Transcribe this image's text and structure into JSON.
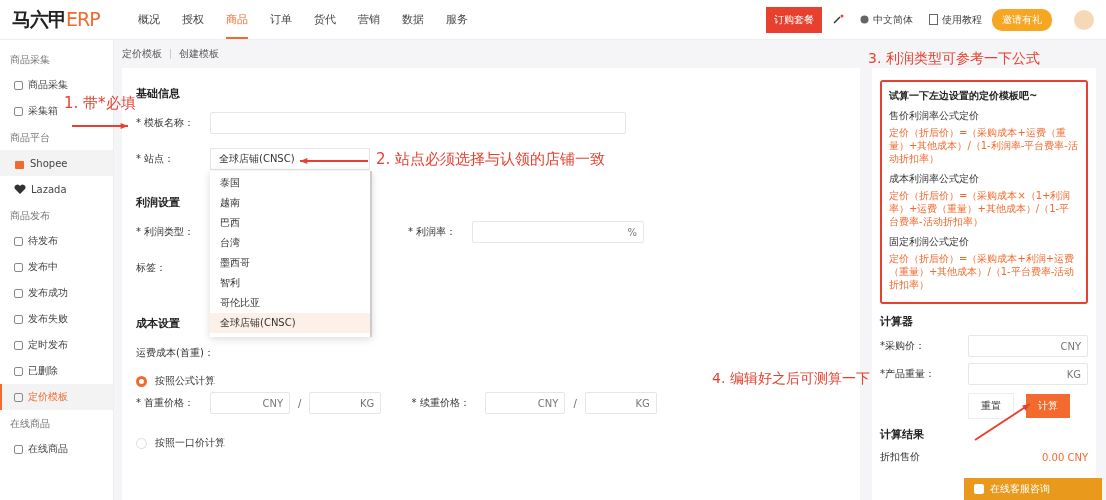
{
  "top_nav": {
    "logo": {
      "main": "马六甲",
      "accent": "ERP"
    },
    "tabs": [
      {
        "label": "概况",
        "selected": false
      },
      {
        "label": "授权",
        "selected": false
      },
      {
        "label": "商品",
        "selected": true
      },
      {
        "label": "订单",
        "selected": false
      },
      {
        "label": "货代",
        "selected": false
      },
      {
        "label": "营销",
        "selected": false
      },
      {
        "label": "数据",
        "selected": false
      },
      {
        "label": "服务",
        "selected": false
      }
    ],
    "order_button": "订购套餐",
    "language": "中文简体",
    "tutorial": "使用教程",
    "invite": "邀请有礼"
  },
  "sidebar": [
    {
      "title": "商品采集",
      "items": [
        {
          "label": "商品采集",
          "kind": "icon",
          "selected": false
        },
        {
          "label": "采集箱",
          "kind": "icon",
          "selected": false
        }
      ]
    },
    {
      "title": "商品平台",
      "items": [
        {
          "label": "Shopee",
          "kind": "shopee",
          "selected": true
        },
        {
          "label": "Lazada",
          "kind": "lazada",
          "selected": false
        }
      ]
    },
    {
      "title": "商品发布",
      "items": [
        {
          "label": "待发布",
          "kind": "icon",
          "selected": false
        },
        {
          "label": "发布中",
          "kind": "icon",
          "selected": false
        },
        {
          "label": "发布成功",
          "kind": "icon",
          "selected": false
        },
        {
          "label": "发布失败",
          "kind": "icon",
          "selected": false
        },
        {
          "label": "定时发布",
          "kind": "icon",
          "selected": false
        },
        {
          "label": "已删除",
          "kind": "icon",
          "selected": false
        },
        {
          "label": "定价模板",
          "kind": "icon",
          "selected": true
        }
      ]
    },
    {
      "title": "在线商品",
      "items": [
        {
          "label": "在线商品",
          "kind": "icon",
          "selected": false
        }
      ]
    }
  ],
  "breadcrumb": [
    "定价模板",
    "创建模板"
  ],
  "form": {
    "basic": {
      "title": "基础信息",
      "name_label": "* 模板名称：",
      "site_label": "* 站点：",
      "site_value": "全球店铺(CNSC)",
      "site_options": [
        {
          "label": "泰国",
          "selected": false
        },
        {
          "label": "越南",
          "selected": false
        },
        {
          "label": "巴西",
          "selected": false
        },
        {
          "label": "台湾",
          "selected": false
        },
        {
          "label": "墨西哥",
          "selected": false
        },
        {
          "label": "智利",
          "selected": false
        },
        {
          "label": "哥伦比亚",
          "selected": false
        },
        {
          "label": "全球店铺(CNSC)",
          "selected": true
        }
      ]
    },
    "profit": {
      "title": "利润设置",
      "type_label": "* 利润类型：",
      "rate_label": "* 利润率：",
      "rate_unit": "%",
      "tag_label": "标签："
    },
    "cost": {
      "title": "成本设置",
      "freight_label": "运费成本(首重)：",
      "methods": [
        {
          "label": "按照公式计算",
          "selected": true
        },
        {
          "label": "按照一口价计算",
          "selected": false
        }
      ],
      "first": {
        "label": "* 首重价格：",
        "currency": "CNY",
        "separator": "/",
        "unit": "KG"
      },
      "next": {
        "label": "* 续重价格：",
        "currency": "CNY",
        "separator": "/",
        "unit": "KG"
      }
    }
  },
  "formulas": {
    "title": "试算一下左边设置的定价模板吧~",
    "items": [
      {
        "name": "售价利润率公式定价",
        "formula": "定价（折后价）=（采购成本+运费（重量）+其他成本）/（1-利润率-平台费率-活动折扣率）"
      },
      {
        "name": "成本利润率公式定价",
        "formula": "定价（折后价）=（采购成本×（1+利润率）+运费（重量）+其他成本）/（1-平台费率-活动折扣率）"
      },
      {
        "name": "固定利润公式定价",
        "formula": "定价（折后价）=（采购成本+利润+运费（重量）+其他成本）/（1-平台费率-活动折扣率）"
      }
    ]
  },
  "calculator": {
    "title": "计算器",
    "fields": [
      {
        "label": "*采购价：",
        "unit": "CNY"
      },
      {
        "label": "*产品重量：",
        "unit": "KG"
      }
    ],
    "reset": "重置",
    "calculate": "计算",
    "result_title": "计算结果",
    "result_label": "折扣售价",
    "result_value": "0.00 CNY"
  },
  "support_button": "在线客服咨询",
  "annotations": [
    {
      "text": "1. 带*必填"
    },
    {
      "text": "2. 站点必须选择与认领的店铺一致"
    },
    {
      "text": "3. 利润类型可参考一下公式"
    },
    {
      "text": "4. 编辑好之后可测算一下"
    }
  ]
}
